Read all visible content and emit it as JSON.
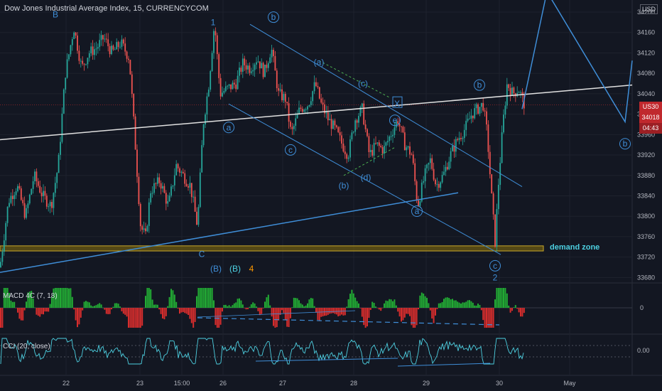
{
  "title": "Dow Jones Industrial Average Index, 15, CURRENCYCOM",
  "currency": "USD",
  "price_tag": {
    "symbol": "US30",
    "price": "34018",
    "countdown": "04:43",
    "value": 34018
  },
  "colors": {
    "up": "#26a69a",
    "down": "#ef5350",
    "bg": "#131722",
    "wave": "#3f8ed8",
    "trend": "#e0e0e0"
  },
  "demand_zone_label": "demand zone",
  "macd_label": "MACD 4C (7, 18)",
  "macd_tick": "0",
  "cci_label": "CCI (20, close)",
  "cci_tick": "0.00",
  "chart_data": {
    "type": "candlestick",
    "x_ticks": [
      "22",
      "23",
      "15:00",
      "26",
      "27",
      "28",
      "29",
      "30",
      "May"
    ],
    "y_ticks": [
      34200,
      34160,
      34120,
      34080,
      34040,
      34000,
      33960,
      33920,
      33880,
      33840,
      33800,
      33760,
      33720,
      33680
    ],
    "ylim": [
      33665,
      34225
    ],
    "price_path": [
      [
        0,
        33700
      ],
      [
        12,
        33830
      ],
      [
        24,
        33860
      ],
      [
        36,
        33800
      ],
      [
        48,
        33880
      ],
      [
        60,
        33840
      ],
      [
        72,
        33820
      ],
      [
        82,
        33900
      ],
      [
        92,
        34080
      ],
      [
        104,
        34170
      ],
      [
        115,
        34090
      ],
      [
        125,
        34120
      ],
      [
        136,
        34130
      ],
      [
        146,
        34150
      ],
      [
        158,
        34120
      ],
      [
        170,
        34140
      ],
      [
        182,
        34110
      ],
      [
        190,
        33950
      ],
      [
        198,
        33780
      ],
      [
        205,
        33760
      ],
      [
        212,
        33850
      ],
      [
        225,
        33870
      ],
      [
        237,
        33820
      ],
      [
        248,
        33900
      ],
      [
        258,
        33880
      ],
      [
        268,
        33860
      ],
      [
        278,
        33780
      ],
      [
        286,
        33980
      ],
      [
        294,
        34060
      ],
      [
        302,
        34180
      ],
      [
        310,
        34040
      ],
      [
        320,
        34050
      ],
      [
        332,
        34060
      ],
      [
        342,
        34100
      ],
      [
        352,
        34090
      ],
      [
        362,
        34110
      ],
      [
        372,
        34080
      ],
      [
        382,
        34130
      ],
      [
        392,
        34040
      ],
      [
        402,
        34030
      ],
      [
        410,
        33960
      ],
      [
        422,
        34010
      ],
      [
        434,
        34020
      ],
      [
        444,
        34060
      ],
      [
        452,
        34020
      ],
      [
        462,
        33990
      ],
      [
        472,
        33970
      ],
      [
        482,
        33940
      ],
      [
        490,
        33920
      ],
      [
        500,
        33990
      ],
      [
        510,
        34010
      ],
      [
        520,
        33920
      ],
      [
        530,
        33940
      ],
      [
        540,
        33930
      ],
      [
        550,
        33960
      ],
      [
        560,
        33990
      ],
      [
        570,
        33940
      ],
      [
        580,
        33920
      ],
      [
        588,
        33820
      ],
      [
        598,
        33880
      ],
      [
        606,
        33910
      ],
      [
        614,
        33860
      ],
      [
        624,
        33880
      ],
      [
        634,
        33920
      ],
      [
        644,
        33950
      ],
      [
        654,
        33970
      ],
      [
        664,
        34000
      ],
      [
        672,
        34010
      ],
      [
        680,
        34020
      ],
      [
        686,
        33960
      ],
      [
        692,
        33840
      ],
      [
        697,
        33750
      ],
      [
        702,
        33870
      ],
      [
        708,
        33980
      ],
      [
        714,
        34060
      ],
      [
        722,
        34040
      ],
      [
        730,
        34050
      ],
      [
        738,
        34020
      ]
    ],
    "trendlines": [
      {
        "kind": "white",
        "p": [
          [
            0,
            33950
          ],
          [
            890,
            34057
          ]
        ]
      },
      {
        "kind": "blue",
        "p": [
          [
            0,
            33690
          ],
          [
            645,
            33846
          ]
        ]
      },
      {
        "kind": "channel",
        "p": [
          [
            352,
            34176
          ],
          [
            735,
            33858
          ]
        ]
      },
      {
        "kind": "channel",
        "p": [
          [
            322,
            34020
          ],
          [
            705,
            33725
          ]
        ]
      },
      {
        "kind": "projection",
        "p": [
          [
            735,
            34010
          ],
          [
            770,
            34240
          ],
          [
            880,
            33985
          ],
          [
            890,
            34105
          ]
        ]
      }
    ],
    "wave_labels": [
      {
        "t": "B",
        "x": 78,
        "y": 34195,
        "circle": false,
        "color": "#3f8ed8"
      },
      {
        "t": "1",
        "x": 300,
        "y": 34180,
        "circle": false,
        "color": "#3f8ed8"
      },
      {
        "t": "b",
        "x": 385,
        "y": 34190,
        "circle": true,
        "color": "#3f8ed8"
      },
      {
        "t": "(a)",
        "x": 449,
        "y": 34102,
        "circle": false,
        "color": "#3f8ed8"
      },
      {
        "t": "(c)",
        "x": 511,
        "y": 34060,
        "circle": false,
        "color": "#3f8ed8"
      },
      {
        "t": "X",
        "x": 559,
        "y": 34020,
        "circle": false,
        "color": "#3f8ed8"
      },
      {
        "t": "e",
        "x": 556,
        "y": 33988,
        "circle": true,
        "color": "#3f8ed8"
      },
      {
        "t": "a",
        "x": 322,
        "y": 33974,
        "circle": true,
        "color": "#3f8ed8"
      },
      {
        "t": "c",
        "x": 409,
        "y": 33930,
        "circle": true,
        "color": "#3f8ed8"
      },
      {
        "t": "(b)",
        "x": 484,
        "y": 33860,
        "circle": false,
        "color": "#3f8ed8"
      },
      {
        "t": "(d)",
        "x": 515,
        "y": 33876,
        "circle": false,
        "color": "#3f8ed8"
      },
      {
        "t": "a",
        "x": 587,
        "y": 33810,
        "circle": true,
        "color": "#3f8ed8"
      },
      {
        "t": "b",
        "x": 675,
        "y": 34057,
        "circle": true,
        "color": "#3f8ed8"
      },
      {
        "t": "c",
        "x": 697,
        "y": 33703,
        "circle": true,
        "color": "#3f8ed8"
      },
      {
        "t": "2",
        "x": 697,
        "y": 33680,
        "circle": false,
        "color": "#3f8ed8"
      },
      {
        "t": "b",
        "x": 880,
        "y": 33942,
        "circle": true,
        "color": "#3f8ed8"
      },
      {
        "t": "C",
        "x": 284,
        "y": 33726,
        "circle": false,
        "color": "#3f8ed8"
      },
      {
        "t": "(B)",
        "x": 304,
        "y": 33697,
        "circle": false,
        "color": "#3f8ed8"
      },
      {
        "t": "(B)",
        "x": 331,
        "y": 33697,
        "circle": false,
        "color": "#4dd0e1"
      },
      {
        "t": "4",
        "x": 354,
        "y": 33697,
        "circle": false,
        "color": "#ff9800"
      }
    ],
    "demand_zone": {
      "x0": 0,
      "x1": 765,
      "y_top": 33742,
      "y_bot": 33732
    }
  }
}
